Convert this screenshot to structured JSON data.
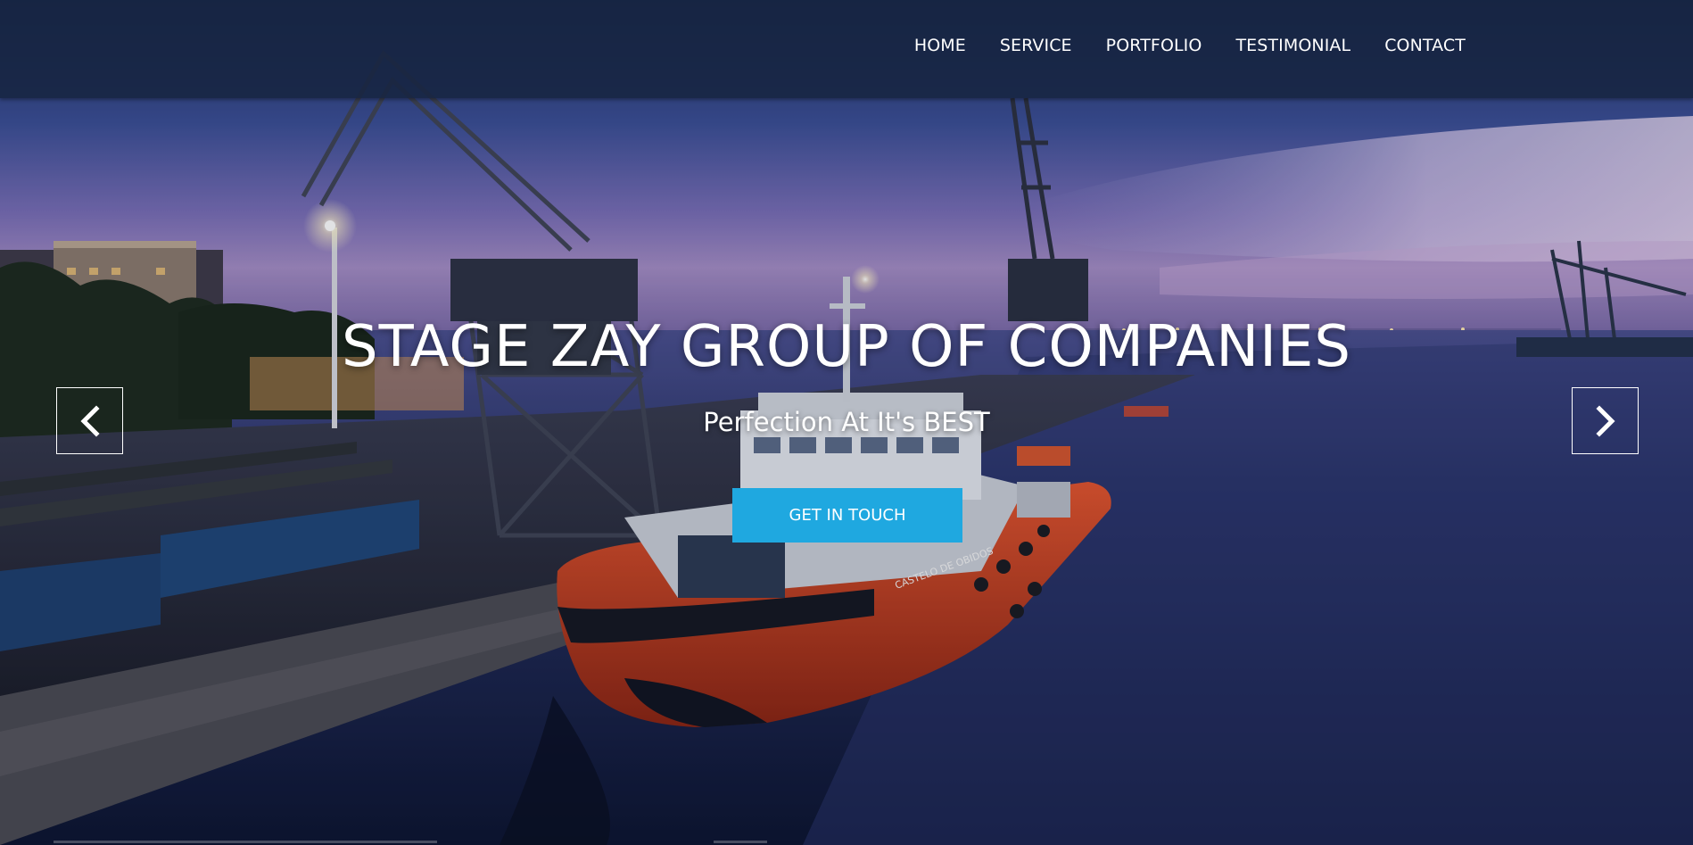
{
  "nav": {
    "items": [
      {
        "label": "HOME"
      },
      {
        "label": "SERVICE"
      },
      {
        "label": "PORTFOLIO"
      },
      {
        "label": "TESTIMONIAL"
      },
      {
        "label": "CONTACT"
      }
    ]
  },
  "hero": {
    "title": "STAGE ZAY GROUP OF COMPANIES",
    "subtitle": "Perfection At It's BEST",
    "cta_label": "GET IN TOUCH",
    "ship_name": "CASTELO DE OBIDOS"
  },
  "colors": {
    "accent": "#1fa8e0",
    "navbar": "#162440",
    "ship_hull": "#d8482a"
  },
  "icons": {
    "prev": "chevron-left-icon",
    "next": "chevron-right-icon"
  }
}
